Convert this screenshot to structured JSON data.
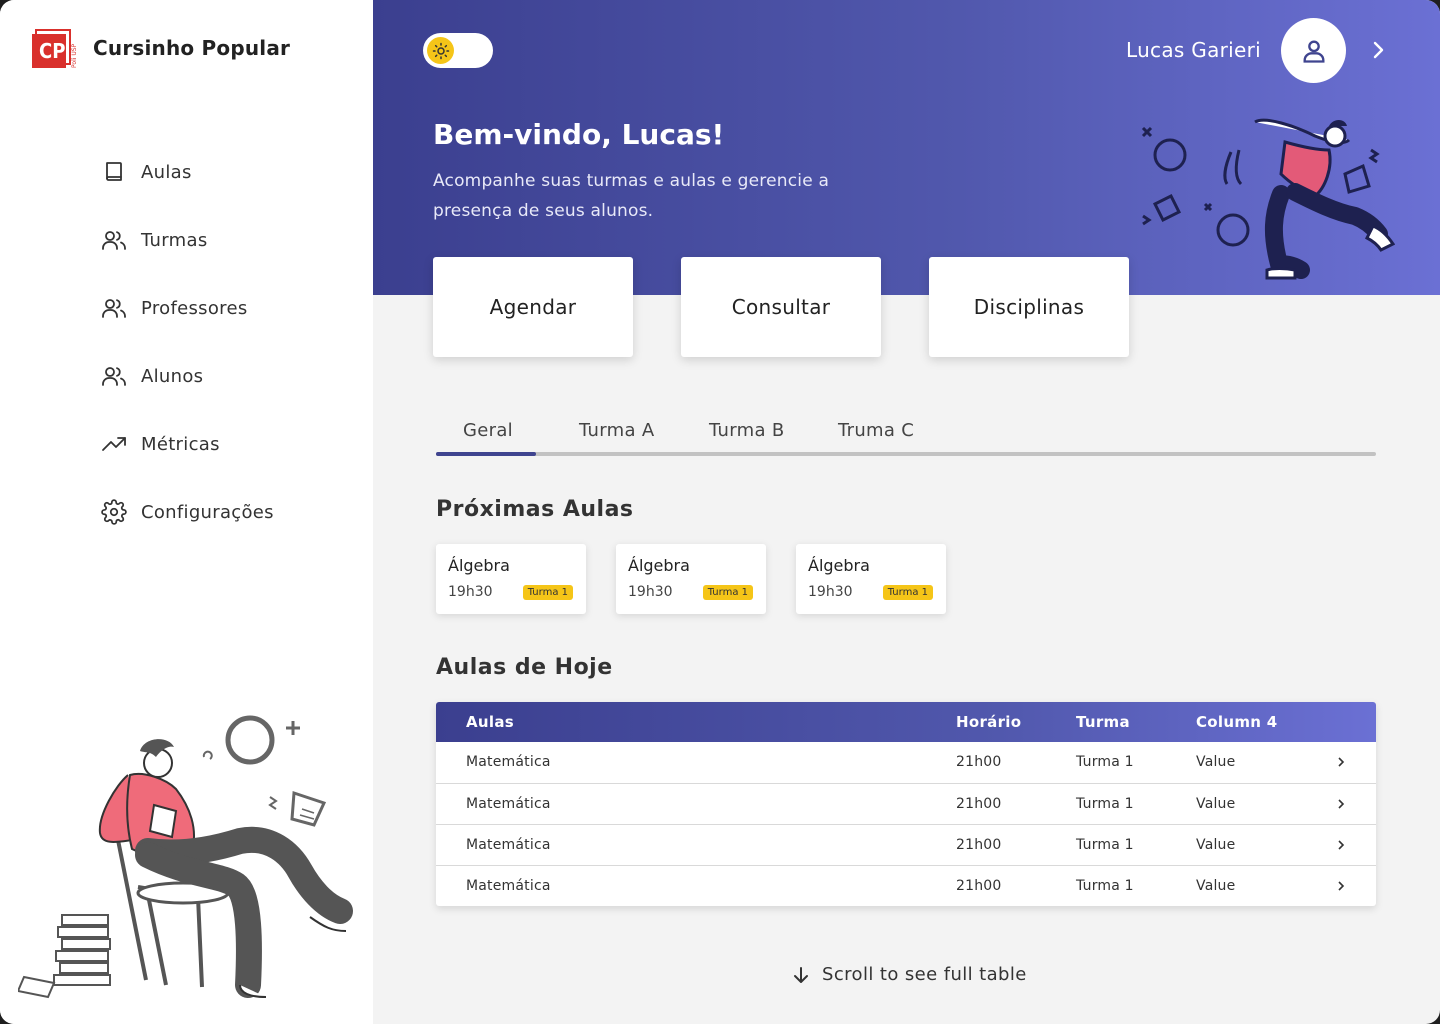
{
  "brand": {
    "name": "Cursinho Popular",
    "logo_letters": "CP",
    "logo_sub": "Poli USP"
  },
  "sidebar": {
    "items": [
      {
        "label": "Aulas",
        "icon": "book-icon"
      },
      {
        "label": "Turmas",
        "icon": "users-icon"
      },
      {
        "label": "Professores",
        "icon": "users-icon"
      },
      {
        "label": "Alunos",
        "icon": "users-icon"
      },
      {
        "label": "Métricas",
        "icon": "trending-up-icon"
      },
      {
        "label": "Configurações",
        "icon": "gear-icon"
      }
    ]
  },
  "header": {
    "theme_toggle": {
      "icon": "sun-icon",
      "state": "light"
    },
    "user_name": "Lucas Garieri",
    "welcome": "Bem-vindo, Lucas!",
    "subtitle": "Acompanhe suas turmas e aulas e gerencie a presença de seus alunos."
  },
  "actions": [
    "Agendar",
    "Consultar",
    "Disciplinas"
  ],
  "tabs": {
    "items": [
      "Geral",
      "Turma A",
      "Turma B",
      "Truma C"
    ],
    "active": "Geral"
  },
  "upcoming": {
    "title": "Próximas Aulas",
    "cards": [
      {
        "subject": "Álgebra",
        "time": "19h30",
        "badge": "Turma 1"
      },
      {
        "subject": "Álgebra",
        "time": "19h30",
        "badge": "Turma 1"
      },
      {
        "subject": "Álgebra",
        "time": "19h30",
        "badge": "Turma 1"
      }
    ]
  },
  "today": {
    "title": "Aulas de Hoje",
    "columns": [
      "Aulas",
      "Horário",
      "Turma",
      "Column 4"
    ],
    "rows": [
      [
        "Matemática",
        "21h00",
        "Turma 1",
        "Value"
      ],
      [
        "Matemática",
        "21h00",
        "Turma 1",
        "Value"
      ],
      [
        "Matemática",
        "21h00",
        "Turma 1",
        "Value"
      ],
      [
        "Matemática",
        "21h00",
        "Turma 1",
        "Value"
      ]
    ]
  },
  "scroll_hint": "Scroll to see full table",
  "colors": {
    "primary": "#3f448f",
    "accent": "#f5c518",
    "background": "#f3f3f3",
    "gradient_end": "#6b70d4"
  }
}
